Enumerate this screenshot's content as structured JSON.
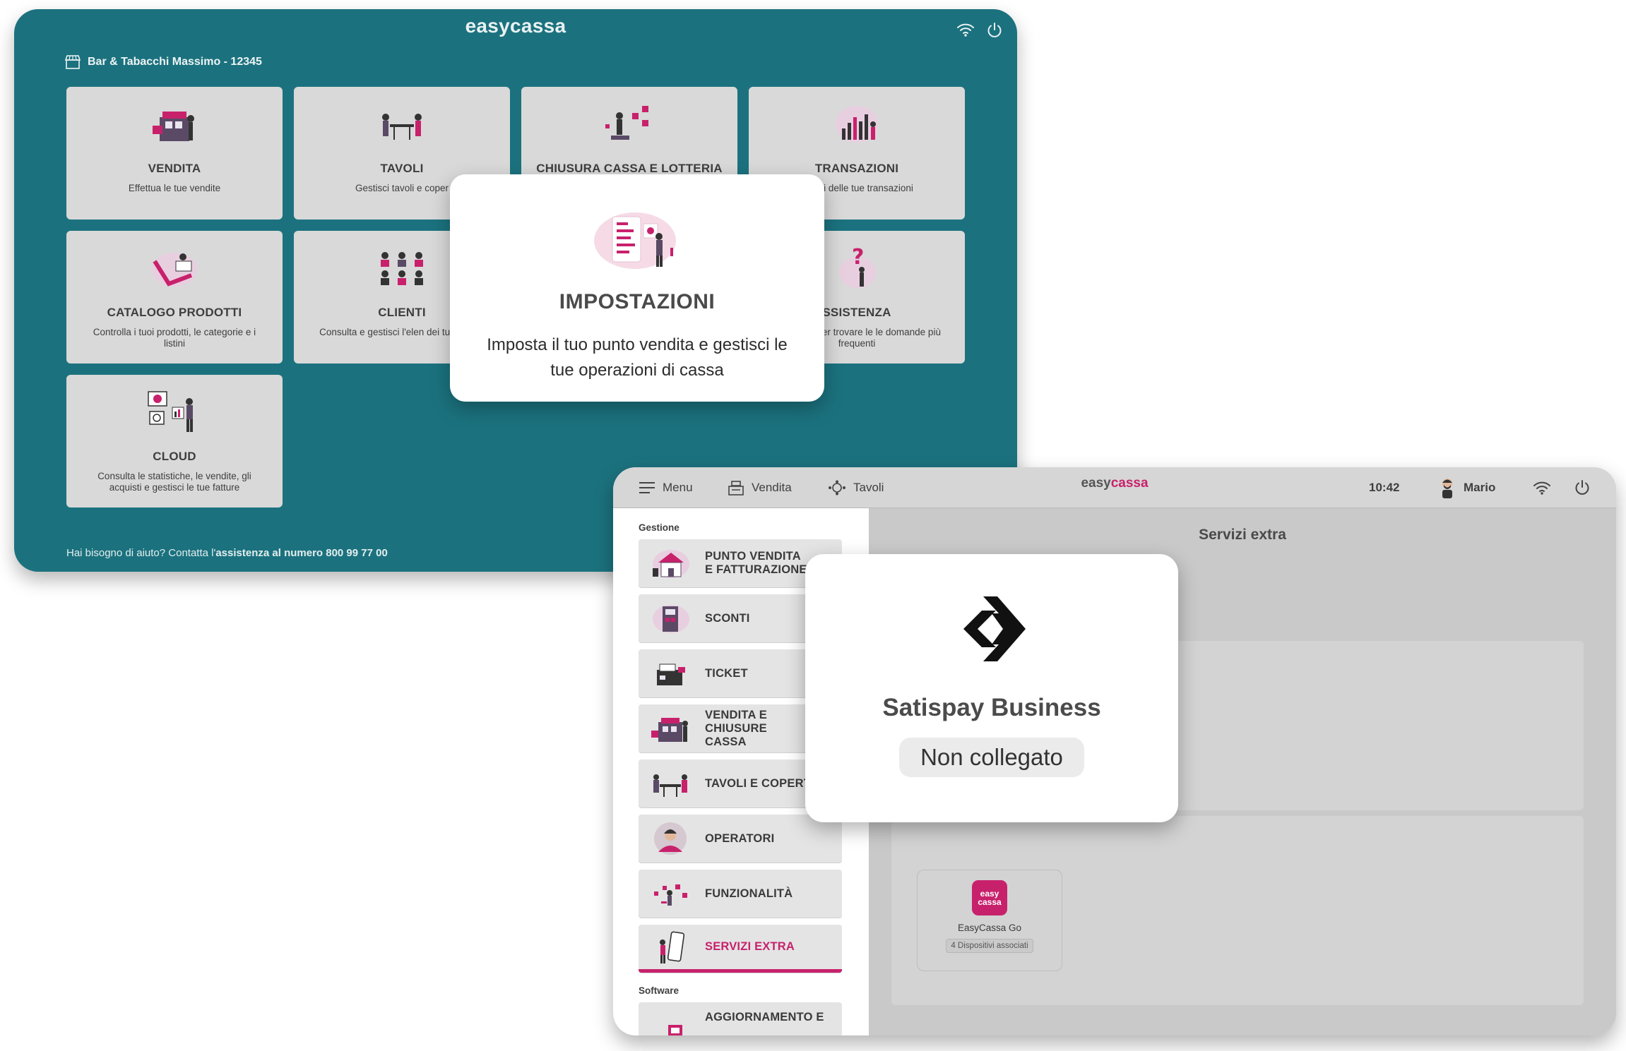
{
  "back_tablet": {
    "app_logo": "easycassa",
    "store_name": "Bar & Tabacchi Massimo - 12345",
    "tiles": [
      {
        "title": "VENDITA",
        "desc": "Effettua le tue vendite"
      },
      {
        "title": "TAVOLI",
        "desc": "Gestisci tavoli e coper"
      },
      {
        "title": "CHIUSURA CASSA E LOTTERIA",
        "desc": ""
      },
      {
        "title": "TRANSAZIONI",
        "desc": "ettagli delle tue transazioni"
      },
      {
        "title": "CATALOGO PRODOTTI",
        "desc": "Controlla i tuoi prodotti, le categorie e i listini"
      },
      {
        "title": "CLIENTI",
        "desc": "Consulta e gestisci l'elen dei tuoi clienti"
      },
      {
        "title": "SSISTENZA",
        "desc": "a le guide per trovare le le domande più frequenti"
      },
      {
        "title": "CLOUD",
        "desc": "Consulta le statistiche, le vendite, gli acquisti e gestisci le tue fatture"
      }
    ],
    "help_prefix": "Hai bisogno di aiuto? Contatta l'",
    "help_bold": "assistenza al numero 800 99 77 00"
  },
  "popup_impostazioni": {
    "title": "IMPOSTAZIONI",
    "desc": "Imposta il tuo punto vendita e gestisci le tue operazioni di cassa"
  },
  "front_tablet": {
    "topbar": {
      "menu": "Menu",
      "vendita": "Vendita",
      "tavoli": "Tavoli",
      "logo_pre": "easy",
      "logo_accent": "cassa",
      "time": "10:42",
      "user": "Mario"
    },
    "sidebar": {
      "section_gestione": "Gestione",
      "items": [
        {
          "label": "PUNTO VENDITA E FATTURAZIONE"
        },
        {
          "label": "SCONTI"
        },
        {
          "label": "TICKET"
        },
        {
          "label": "VENDITA E CHIUSURE CASSA"
        },
        {
          "label": "TAVOLI E COPERTI"
        },
        {
          "label": "OPERATORI"
        },
        {
          "label": "FUNZIONALITÀ"
        },
        {
          "label": "SERVIZI EXTRA"
        }
      ],
      "section_software": "Software",
      "software_items": [
        {
          "label": "AGGIORNAMENTO E"
        }
      ]
    },
    "main": {
      "title": "Servizi extra",
      "device": {
        "logo_line1": "easy",
        "logo_line2": "cassa",
        "name": "EasyCassa Go",
        "sub": "4 Dispositivi associati"
      }
    }
  },
  "popup_satispay": {
    "title": "Satispay Business",
    "status": "Non collegato"
  },
  "colors": {
    "teal": "#1b727e",
    "accent": "#c8216c",
    "tile_bg": "#d9d9d9"
  }
}
